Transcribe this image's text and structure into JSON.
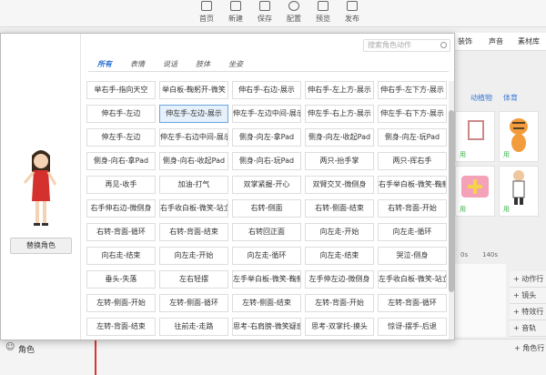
{
  "toolbar": {
    "items": [
      {
        "label": "首页",
        "icon": "home-icon"
      },
      {
        "label": "新建",
        "icon": "new-icon"
      },
      {
        "label": "保存",
        "icon": "save-icon"
      },
      {
        "label": "配置",
        "icon": "gear-icon"
      },
      {
        "label": "预览",
        "icon": "preview-icon"
      },
      {
        "label": "发布",
        "icon": "publish-icon"
      }
    ]
  },
  "right_panel": {
    "tabs": [
      "装饰",
      "声音",
      "素材库"
    ],
    "subtabs": [
      "动植物",
      "体育"
    ],
    "cards": [
      "用",
      "用",
      "用",
      "用"
    ]
  },
  "timeline": {
    "ruler": [
      "0s",
      "140s"
    ],
    "rows": [
      "+ 动作行",
      "+ 镜头",
      "+ 特效行",
      "+ 音轨",
      "+ 角色行"
    ]
  },
  "bottom": {
    "role_label": "角色"
  },
  "dialog": {
    "search_placeholder": "搜索角色动作",
    "replace_button": "替换角色",
    "tabs": [
      "所有",
      "表情",
      "说话",
      "肢体",
      "坐姿"
    ],
    "active_tab": 0,
    "actions": [
      [
        "举右手-指向天空",
        "举白板-鞠躬开-微笑",
        "伸右手-右边-展示",
        "伸右手-左上方-展示",
        "伸右手-左下方-展示"
      ],
      [
        "伸右手-左边",
        "伸左手-左边-展示",
        "伸左手-左边中间-展示",
        "伸左手-右上方-展示",
        "伸左手-右下方-展示"
      ],
      [
        "伸左手-左边",
        "伸左手-右边中间-展示",
        "侧身-向左-拿Pad",
        "侧身-向左-收起Pad",
        "侧身-向左-玩Pad"
      ],
      [
        "侧身-向右-拿Pad",
        "侧身-向右-收起Pad",
        "侧身-向右-玩Pad",
        "两只-抬手掌",
        "两只-挥右手"
      ],
      [
        "再见-收手",
        "加油-打气",
        "双掌紧握-开心",
        "双臂交叉-微侧身",
        "右手举白板-微笑-鞠躬开"
      ],
      [
        "右手伸右边-微侧身",
        "右手收白板-微笑-站立",
        "右转-侧面",
        "右转-侧面-结束",
        "右转-背面-开始"
      ],
      [
        "右转-背面-循环",
        "右转-背面-结束",
        "右转回正面",
        "向左走-开始",
        "向左走-循环"
      ],
      [
        "向右走-结束",
        "向左走-开始",
        "向左走-循环",
        "向左走-结束",
        "哭泣-侧身"
      ],
      [
        "垂头-失落",
        "左右轻摆",
        "左手举白板-微笑-鞠躬开",
        "左手伸左边-微侧身",
        "左手收白板-微笑-站立"
      ],
      [
        "左转-侧面-开始",
        "左转-侧面-循环",
        "左转-侧面-结束",
        "左转-背面-开始",
        "左转-背面-循环"
      ],
      [
        "左转-背面-结束",
        "往前走-走路",
        "思考-右肩膀-微笑疑惑",
        "思考-双掌托-摸头",
        "惊讶-摆手-后退"
      ]
    ]
  }
}
